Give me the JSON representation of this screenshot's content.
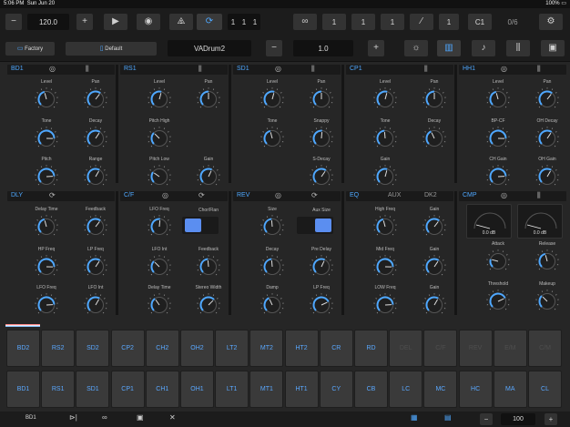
{
  "status": {
    "time": "5:06 PM",
    "date": "Sun Jun 20",
    "battery": "100%"
  },
  "toolbar": {
    "tempo": "120.0",
    "position": [
      "1",
      "1",
      "1"
    ],
    "loop_vals": [
      "1",
      "1",
      "1"
    ],
    "step": "1",
    "note": "C1",
    "count": "0/6"
  },
  "kit": {
    "bank": "Factory",
    "preset": "Default",
    "name": "VADrum2",
    "value": "1.0"
  },
  "sections": {
    "bd1": {
      "title": "BD1",
      "knobs": [
        "Level",
        "Pan",
        "Tone",
        "Decay",
        "Pitch",
        "Range"
      ]
    },
    "rs1": {
      "title": "RS1",
      "knobs": [
        "Level",
        "Pan",
        "Pitch High",
        "Pitch Low",
        "Gain"
      ]
    },
    "sd1": {
      "title": "SD1",
      "knobs": [
        "Level",
        "Pan",
        "Tone",
        "Snappy",
        "S-Decay"
      ]
    },
    "cp1": {
      "title": "CP1",
      "knobs": [
        "Level",
        "Pan",
        "Tone",
        "Decay",
        "Gain"
      ]
    },
    "hh1": {
      "title": "HH1",
      "knobs": [
        "Level",
        "Pan",
        "BP-CF",
        "OH Decay",
        "CH Gain",
        "OH Gain"
      ]
    },
    "dly": {
      "title": "DLY",
      "knobs": [
        "Delay Time",
        "Feedback",
        "HP Freq",
        "LP Freq",
        "LFO Freq",
        "LFO Int"
      ]
    },
    "cf": {
      "title": "C/F",
      "knobs": [
        "LFO Freq",
        "LFO Int",
        "Delay Time",
        "Feedback",
        "Stereo Width"
      ],
      "toggle": "Chor/Flan"
    },
    "rev": {
      "title": "REV",
      "knobs": [
        "Size",
        "Decay",
        "Pre Delay",
        "Damp",
        "LP Freq"
      ],
      "toggle": "Aux Size"
    },
    "eq": {
      "title": "EQ",
      "tabs": [
        "AUX",
        "DK2"
      ],
      "knobs": [
        "High Freq",
        "Gain",
        "Mid Freq",
        "Gain",
        "LOW Freq",
        "Gain"
      ]
    },
    "cmp": {
      "title": "CMP",
      "meters": [
        "0.0 dB",
        "0.0 dB"
      ],
      "knobs": [
        "Attack",
        "Release",
        "Threshold",
        "Makeup"
      ]
    }
  },
  "pads_top": [
    "BD2",
    "RS2",
    "SD2",
    "CP2",
    "CH2",
    "OH2",
    "LT2",
    "MT2",
    "HT2",
    "CR",
    "RD",
    "DEL",
    "C/F",
    "REV",
    "E/M",
    "C/M"
  ],
  "pads_bottom": [
    "BD1",
    "RS1",
    "SD1",
    "CP1",
    "CH1",
    "OH1",
    "LT1",
    "MT1",
    "HT1",
    "CY",
    "CB",
    "LC",
    "MC",
    "HC",
    "MA",
    "CL"
  ],
  "bottom": {
    "track": "BD1",
    "zoom": "100"
  },
  "colors": {
    "accent": "#4fa8ff",
    "pad": "#3a3a3a",
    "toggle": "#5b8ef0"
  }
}
